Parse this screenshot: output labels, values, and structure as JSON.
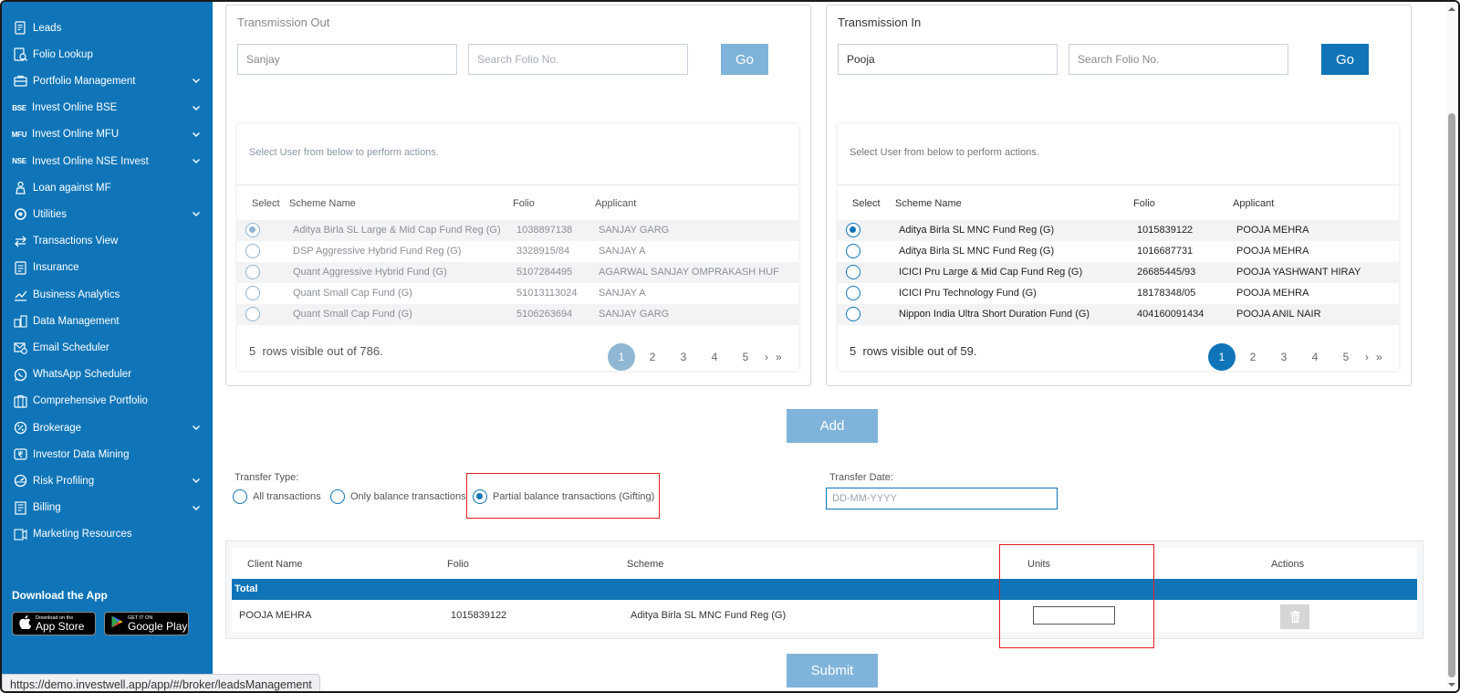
{
  "sidebar": {
    "items": [
      {
        "label": "Leads",
        "icon": "leads-icon",
        "chevron": false
      },
      {
        "label": "Folio Lookup",
        "icon": "folio-lookup-icon",
        "chevron": false
      },
      {
        "label": "Portfolio Management",
        "icon": "briefcase-icon",
        "chevron": true
      },
      {
        "label": "Invest Online BSE",
        "icon": "bse-icon",
        "chevron": true,
        "badge": "BSE"
      },
      {
        "label": "Invest Online MFU",
        "icon": "mfu-icon",
        "chevron": true,
        "badge": "MFU"
      },
      {
        "label": "Invest Online NSE Invest",
        "icon": "nse-icon",
        "chevron": true,
        "badge": "NSE"
      },
      {
        "label": "Loan against MF",
        "icon": "loan-icon",
        "chevron": false
      },
      {
        "label": "Utilities",
        "icon": "utilities-icon",
        "chevron": true
      },
      {
        "label": "Transactions View",
        "icon": "transactions-icon",
        "chevron": false
      },
      {
        "label": "Insurance",
        "icon": "insurance-icon",
        "chevron": false
      },
      {
        "label": "Business Analytics",
        "icon": "analytics-icon",
        "chevron": false
      },
      {
        "label": "Data Management",
        "icon": "data-management-icon",
        "chevron": false
      },
      {
        "label": "Email Scheduler",
        "icon": "email-icon",
        "chevron": false
      },
      {
        "label": "WhatsApp Scheduler",
        "icon": "whatsapp-icon",
        "chevron": false
      },
      {
        "label": "Comprehensive Portfolio",
        "icon": "portfolio-icon",
        "chevron": false
      },
      {
        "label": "Brokerage",
        "icon": "brokerage-icon",
        "chevron": true
      },
      {
        "label": "Investor Data Mining",
        "icon": "rupee-icon",
        "chevron": false
      },
      {
        "label": "Risk Profiling",
        "icon": "risk-icon",
        "chevron": true
      },
      {
        "label": "Billing",
        "icon": "billing-icon",
        "chevron": true
      },
      {
        "label": "Marketing Resources",
        "icon": "marketing-icon",
        "chevron": false
      }
    ],
    "download_title": "Download the App",
    "app_store": {
      "small": "Download on the",
      "big": "App Store"
    },
    "google_play": {
      "small": "GET IT ON",
      "big": "Google Play"
    }
  },
  "transmission_out": {
    "title": "Transmission Out",
    "name_value": "Sanjay",
    "folio_placeholder": "Search Folio No.",
    "go_label": "Go",
    "hint": "Select User from below to perform actions.",
    "columns": [
      "Select",
      "Scheme Name",
      "Folio",
      "Applicant"
    ],
    "rows": [
      {
        "selected": true,
        "scheme": "Aditya Birla SL Large & Mid Cap Fund Reg (G)",
        "folio": "1038897138",
        "applicant": "SANJAY GARG"
      },
      {
        "selected": false,
        "scheme": "DSP Aggressive Hybrid Fund Reg (G)",
        "folio": "3328915/84",
        "applicant": "SANJAY A"
      },
      {
        "selected": false,
        "scheme": "Quant Aggressive Hybrid Fund (G)",
        "folio": "5107284495",
        "applicant": "AGARWAL SANJAY OMPRAKASH HUF"
      },
      {
        "selected": false,
        "scheme": "Quant Small Cap Fund (G)",
        "folio": "51013113024",
        "applicant": "SANJAY A"
      },
      {
        "selected": false,
        "scheme": "Quant Small Cap Fund (G)",
        "folio": "5106263694",
        "applicant": "SANJAY GARG"
      }
    ],
    "rows_count": "5",
    "rows_visible_text": "rows visible out of 786.",
    "pages": [
      "1",
      "2",
      "3",
      "4",
      "5"
    ],
    "next": "›",
    "last": "»"
  },
  "transmission_in": {
    "title": "Transmission In",
    "name_value": "Pooja",
    "folio_placeholder": "Search Folio No.",
    "go_label": "Go",
    "hint": "Select User from below to perform actions.",
    "columns": [
      "Select",
      "Scheme Name",
      "Folio",
      "Applicant"
    ],
    "rows": [
      {
        "selected": true,
        "scheme": "Aditya Birla SL MNC Fund Reg (G)",
        "folio": "1015839122",
        "applicant": "POOJA MEHRA"
      },
      {
        "selected": false,
        "scheme": "Aditya Birla SL MNC Fund Reg (G)",
        "folio": "1016687731",
        "applicant": "POOJA MEHRA"
      },
      {
        "selected": false,
        "scheme": "ICICI Pru Large & Mid Cap Fund Reg (G)",
        "folio": "26685445/93",
        "applicant": "POOJA YASHWANT HIRAY"
      },
      {
        "selected": false,
        "scheme": "ICICI Pru Technology Fund (G)",
        "folio": "18178348/05",
        "applicant": "POOJA MEHRA"
      },
      {
        "selected": false,
        "scheme": "Nippon India Ultra Short Duration Fund (G)",
        "folio": "404160091434",
        "applicant": "POOJA ANIL NAIR"
      }
    ],
    "rows_count": "5",
    "rows_visible_text": "rows visible out of 59.",
    "pages": [
      "1",
      "2",
      "3",
      "4",
      "5"
    ],
    "next": "›",
    "last": "»"
  },
  "add_label": "Add",
  "transfer_type": {
    "label": "Transfer Type:",
    "options": [
      "All transactions",
      "Only balance transactions",
      "Partial balance transactions (Gifting)"
    ],
    "selected_index": 2
  },
  "transfer_date": {
    "label": "Transfer Date:",
    "placeholder": "DD-MM-YYYY"
  },
  "summary_table": {
    "columns": [
      "Client Name",
      "Folio",
      "Scheme",
      "Units",
      "Actions"
    ],
    "total_label": "Total",
    "row": {
      "client": "POOJA MEHRA",
      "folio": "1015839122",
      "scheme": "Aditya Birla SL MNC Fund Reg (G)",
      "units": ""
    }
  },
  "submit_label": "Submit",
  "status_url": "https://demo.investwell.app/app/#/broker/leadsManagement",
  "colors": {
    "primary": "#0f75b8",
    "primary_muted": "#7fb3d9",
    "highlight": "#e02020"
  }
}
